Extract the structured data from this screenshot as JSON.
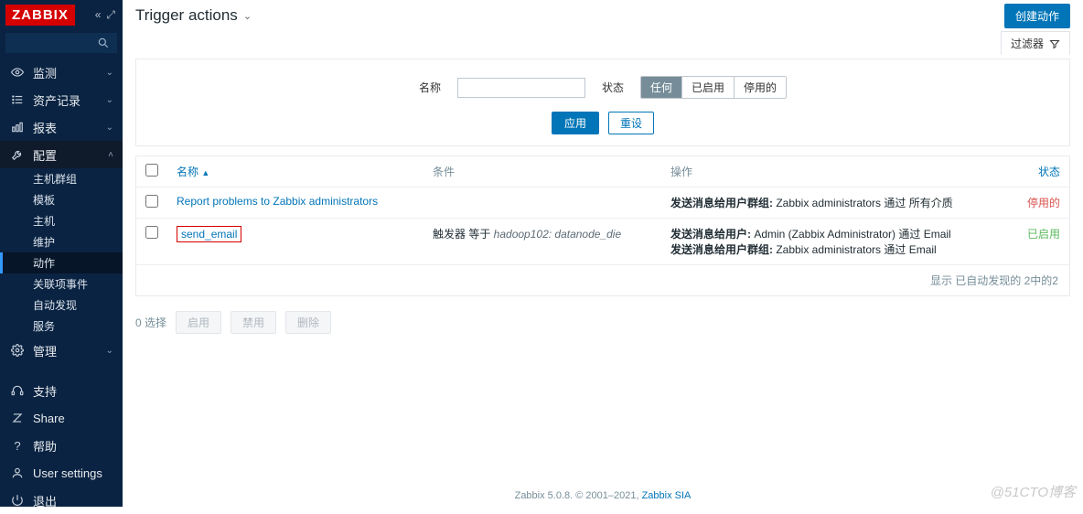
{
  "brand": "ZABBIX",
  "search": {
    "placeholder": ""
  },
  "nav": {
    "monitor": "监测",
    "inventory": "资产记录",
    "reports": "报表",
    "config": "配置",
    "admin": "管理",
    "support": "支持",
    "share": "Share",
    "help": "帮助",
    "user_settings": "User settings",
    "logout": "退出"
  },
  "config_sub": {
    "hostgroups": "主机群组",
    "templates": "模板",
    "hosts": "主机",
    "maintenance": "维护",
    "actions": "动作",
    "correlation": "关联项事件",
    "discovery": "自动发现",
    "services": "服务"
  },
  "page": {
    "title": "Trigger actions",
    "create_btn": "创建动作",
    "filter_tab": "过滤器"
  },
  "filter": {
    "name_label": "名称",
    "status_label": "状态",
    "status_any": "任何",
    "status_enabled": "已启用",
    "status_disabled": "停用的",
    "apply": "应用",
    "reset": "重设"
  },
  "table": {
    "headers": {
      "name": "名称",
      "conditions": "条件",
      "operations": "操作",
      "status": "状态"
    },
    "rows": [
      {
        "name": "Report problems to Zabbix administrators",
        "conditions": "",
        "op_lines": [
          {
            "prefix": "发送消息给用户群组:",
            "body": " Zabbix administrators 通过 所有介质"
          }
        ],
        "status": "停用的",
        "status_class": "status-dis",
        "highlight": false
      },
      {
        "name": "send_email",
        "conditions_prefix": "触发器 等于 ",
        "conditions_ital": "hadoop102: datanode_die",
        "op_lines": [
          {
            "prefix": "发送消息给用户:",
            "body": " Admin (Zabbix Administrator) 通过 Email"
          },
          {
            "prefix": "发送消息给用户群组:",
            "body": " Zabbix administrators 通过 Email"
          }
        ],
        "status": "已启用",
        "status_class": "status-en",
        "highlight": true
      }
    ],
    "footer": "显示 已自动发现的 2中的2"
  },
  "bulk": {
    "selected": "0 选择",
    "enable": "启用",
    "disable": "禁用",
    "delete": "删除"
  },
  "footer_text": {
    "a": "Zabbix 5.0.8. © 2001–2021, ",
    "link": "Zabbix SIA"
  },
  "watermark": "@51CTO博客"
}
